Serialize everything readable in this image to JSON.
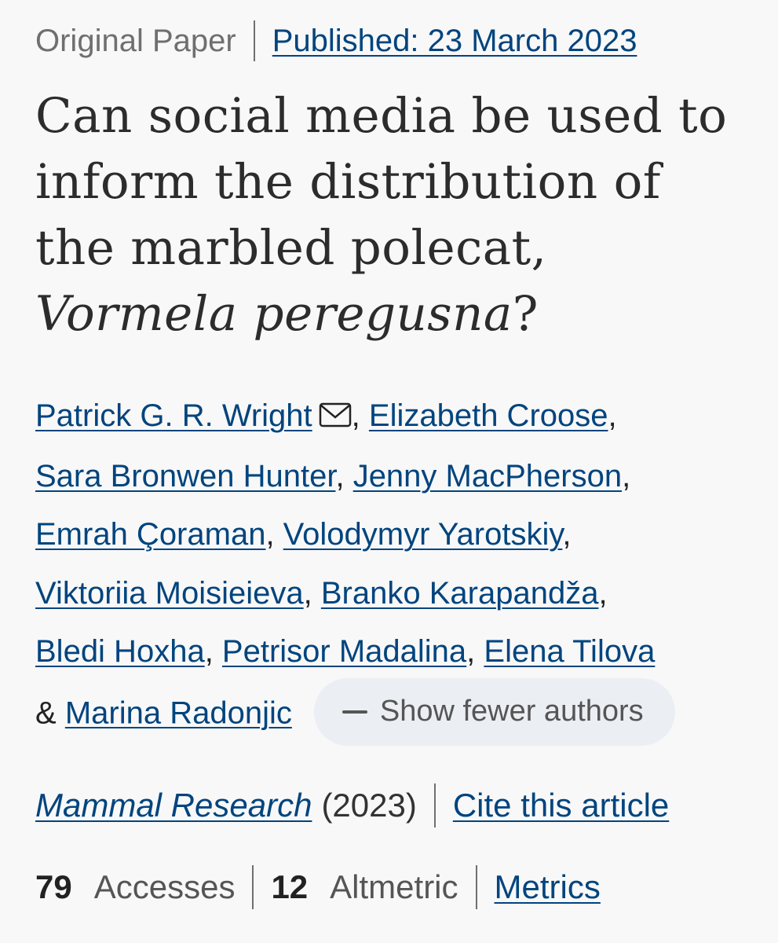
{
  "header": {
    "article_type": "Original Paper",
    "published": "Published: 23 March 2023"
  },
  "title": {
    "main": "Can social media be used to inform the distribution of the marbled polecat, ",
    "species": "Vormela peregusna",
    "end": "?"
  },
  "authors": {
    "list": [
      "Patrick G. R. Wright",
      "Elizabeth Croose",
      "Sara Bronwen Hunter",
      "Jenny MacPherson",
      "Emrah Çoraman",
      "Volodymyr Yarotskiy",
      "Viktoriia Moisieieva",
      "Branko Karapandža",
      "Bledi Hoxha",
      "Petrisor Madalina",
      "Elena Tilova",
      "Marina Radonjic"
    ],
    "ampersand": "&",
    "show_fewer_label": "Show fewer authors"
  },
  "journal": {
    "name": "Mammal Research",
    "year": "(2023)",
    "cite_label": "Cite this article"
  },
  "metrics": {
    "accesses_count": "79",
    "accesses_label": "Accesses",
    "altmetric_count": "12",
    "altmetric_label": "Altmetric",
    "metrics_link": "Metrics"
  },
  "colors": {
    "link": "#01447e",
    "background": "#f8f8f8",
    "pill": "#ebeef3"
  }
}
